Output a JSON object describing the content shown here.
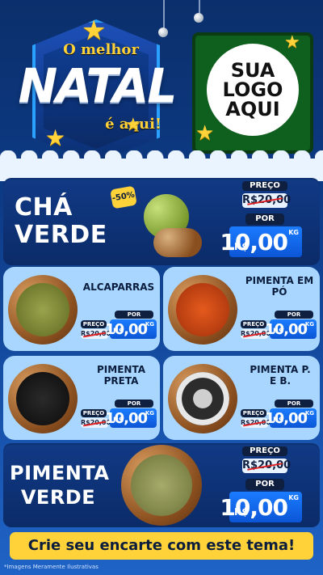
{
  "header": {
    "o_melhor": "O melhor",
    "natal": "NATAL",
    "e_aqui": "é aqui!",
    "logo_lines": [
      "SUA",
      "LOGO",
      "AQUI"
    ]
  },
  "products": {
    "cha_verde": {
      "title_lines": [
        "CHÁ",
        "VERDE"
      ],
      "discount_badge": "-50%",
      "price_label": "PREÇO",
      "old_price": "R$20,00",
      "por_label": "POR",
      "currency": "R$",
      "new_price": "10,00",
      "unit": "KG"
    },
    "alcaparras": {
      "title": "ALCAPARRAS",
      "price_label": "PREÇO",
      "old_price": "R$20,00",
      "por_label": "POR",
      "currency": "R$",
      "new_price": "10,00",
      "unit": "KG"
    },
    "pimenta_po": {
      "title_lines": [
        "PIMENTA EM",
        "PÓ"
      ],
      "price_label": "PREÇO",
      "old_price": "R$20,00",
      "por_label": "POR",
      "currency": "R$",
      "new_price": "10,00",
      "unit": "KG"
    },
    "pimenta_preta": {
      "title_lines": [
        "PIMENTA",
        "PRETA"
      ],
      "price_label": "PREÇO",
      "old_price": "R$20,00",
      "por_label": "POR",
      "currency": "R$",
      "new_price": "10,00",
      "unit": "KG"
    },
    "pimenta_pb": {
      "title_lines": [
        "PIMENTA P.",
        "E B."
      ],
      "price_label": "PREÇO",
      "old_price": "R$20,00",
      "por_label": "POR",
      "currency": "R$",
      "new_price": "10,00",
      "unit": "KG"
    },
    "pimenta_verde": {
      "title_lines": [
        "PIMENTA",
        "VERDE"
      ],
      "price_label": "PREÇO",
      "old_price": "R$20,00",
      "por_label": "POR",
      "currency": "R$",
      "new_price": "10,00",
      "unit": "KG"
    }
  },
  "footer": {
    "cta": "Crie seu encarte com este tema!",
    "disclaimer": "*Imagens Meramente Ilustrativas"
  },
  "colors": {
    "accent_yellow": "#ffd23a",
    "panel_blue": "#113a86",
    "card_light_blue": "#a9d6ff",
    "price_blue": "#0b56d6",
    "strike_red": "#e02020"
  },
  "icons": [
    "star-icon",
    "ornament-icon"
  ]
}
